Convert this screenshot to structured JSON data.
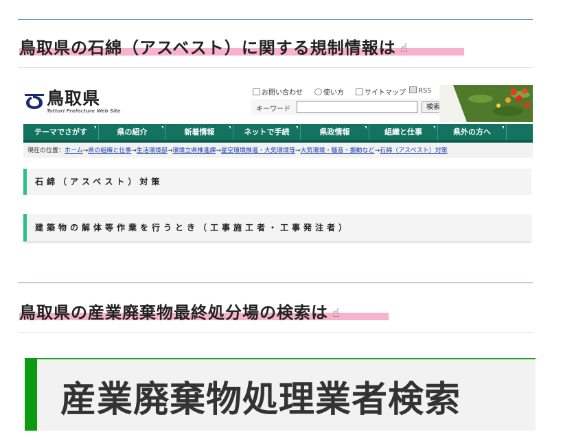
{
  "sections": [
    {
      "title": "鳥取県の石綿（アスベスト）に関する規制情報は",
      "icon": "pointing-hand-icon"
    },
    {
      "title": "鳥取県の産業廃棄物最終処分場の検索は",
      "icon": "pointing-hand-icon"
    }
  ],
  "tottori": {
    "logo_text": "鳥取県",
    "logo_sub": "Tottori Prefecture Web Site",
    "util_links": [
      "お問い合わせ",
      "使い方",
      "サイトマップ"
    ],
    "rss": "RSS",
    "keyword_label": "キーワード",
    "keyword_value": "",
    "search_button": "検索",
    "nav": [
      "テーマでさがす",
      "県の紹介",
      "新着情報",
      "ネットで手続",
      "県政情報",
      "組織と仕事",
      "県外の方へ"
    ],
    "breadcrumb_prefix": "現在の位置：",
    "breadcrumb": [
      "ホーム",
      "県の組織と仕事",
      "生活環境部",
      "環境立県推進課",
      "星空環境推進・大気環境等",
      "大気環境・騒音・振動など",
      "石綿（アスベスト）対策"
    ],
    "bar1": "石綿（アスベスト）対策",
    "bar2": "建築物の解体等作業を行うとき（工事施工者・工事発注者）"
  },
  "banner": {
    "title": "産業廃棄物処理業者検索"
  },
  "colors": {
    "nav": "#137360",
    "accent_teal": "#2ebf8c",
    "accent_green": "#0c9a12",
    "highlight": "#f7b3cc",
    "link": "#1a3fb0"
  }
}
